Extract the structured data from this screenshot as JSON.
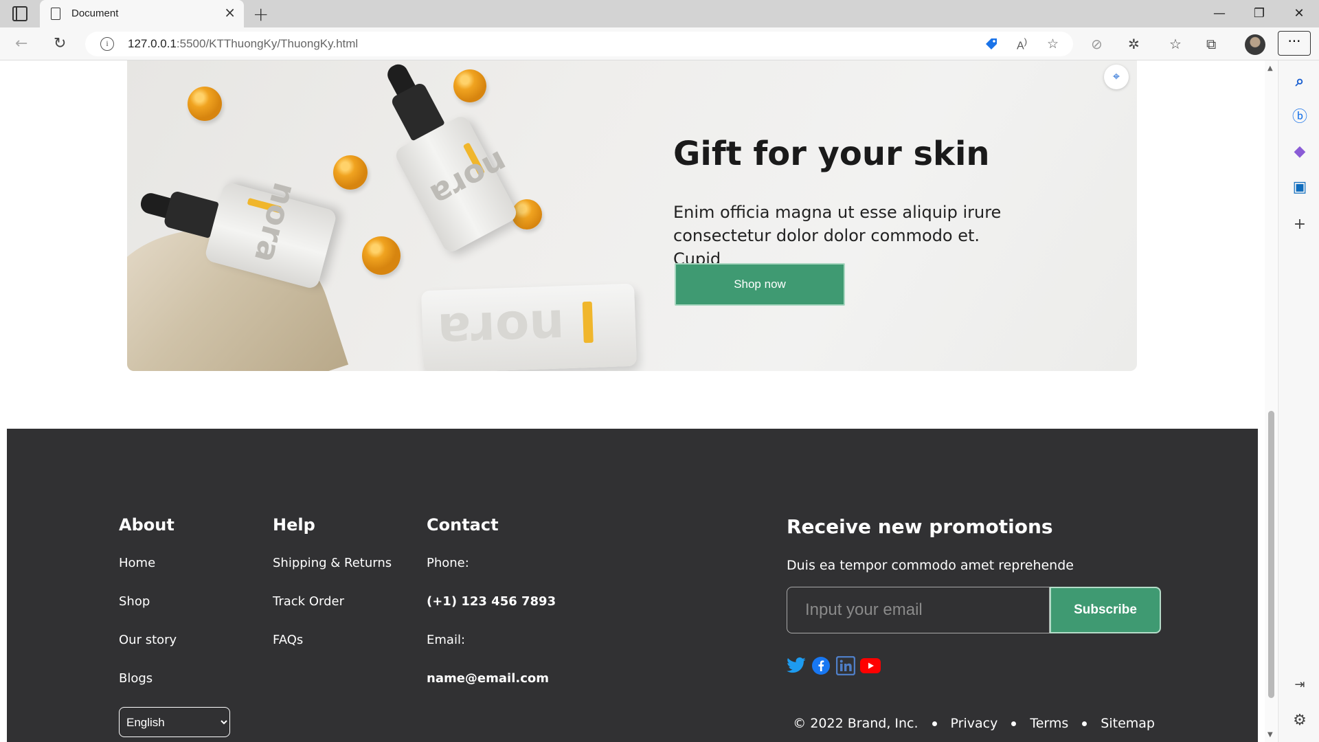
{
  "browser": {
    "tab_title": "Document",
    "url_host": "127.0.0.1",
    "url_path": ":5500/KTThuongKy/ThuongKy.html"
  },
  "hero": {
    "title": "Gift for your skin",
    "description": "Enim officia magna ut esse aliquip irure consectetur dolor dolor commodo et. Cupid",
    "button_label": "Shop now",
    "product_brand": "nora"
  },
  "footer": {
    "about": {
      "heading": "About",
      "links": [
        "Home",
        "Shop",
        "Our story",
        "Blogs"
      ]
    },
    "help": {
      "heading": "Help",
      "links": [
        "Shipping & Returns",
        "Track Order",
        "FAQs"
      ]
    },
    "contact": {
      "heading": "Contact",
      "phone_label": "Phone:",
      "phone_value": "(+1) 123 456 7893",
      "email_label": "Email:",
      "email_value": "name@email.com"
    },
    "promotions": {
      "heading": "Receive new promotions",
      "subtext": "Duis ea tempor commodo amet reprehende",
      "email_placeholder": "Input your email",
      "subscribe_label": "Subscribe"
    },
    "social_icons": [
      "twitter-icon",
      "facebook-icon",
      "linkedin-icon",
      "youtube-icon"
    ],
    "language_selected": "English",
    "bottom_links": {
      "copyright": "© 2022 Brand, Inc.",
      "privacy": "Privacy",
      "terms": "Terms",
      "sitemap": "Sitemap"
    }
  },
  "colors": {
    "accent_green": "#3f9a72",
    "footer_bg": "#313133"
  }
}
